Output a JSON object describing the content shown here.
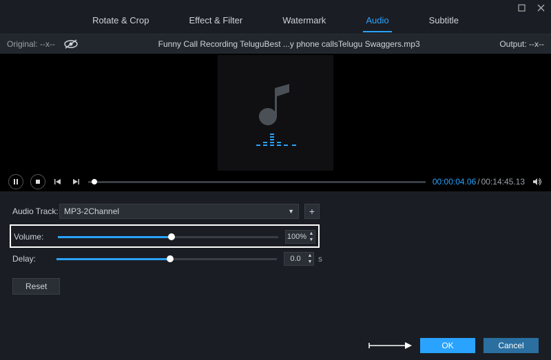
{
  "window": {
    "max_icon": "max",
    "close_icon": "close"
  },
  "tabs": [
    {
      "label": "Rotate & Crop",
      "active": false
    },
    {
      "label": "Effect & Filter",
      "active": false
    },
    {
      "label": "Watermark",
      "active": false
    },
    {
      "label": "Audio",
      "active": true
    },
    {
      "label": "Subtitle",
      "active": false
    }
  ],
  "infobar": {
    "original_label": "Original: --x--",
    "filename": "Funny Call Recording TeluguBest ...y phone callsTelugu Swaggers.mp3",
    "output_label": "Output: --x--"
  },
  "player": {
    "current_time": "00:00:04.06",
    "separator": "/",
    "total_time": "00:14:45.13"
  },
  "settings": {
    "audiotrack_label": "Audio Track:",
    "audiotrack_value": "MP3-2Channel",
    "volume_label": "Volume:",
    "volume_value": "100%",
    "volume_fill_percent": 50,
    "delay_label": "Delay:",
    "delay_value": "0.0",
    "delay_unit": "s",
    "delay_fill_percent": 50,
    "reset_label": "Reset"
  },
  "footer": {
    "ok_label": "OK",
    "cancel_label": "Cancel"
  }
}
